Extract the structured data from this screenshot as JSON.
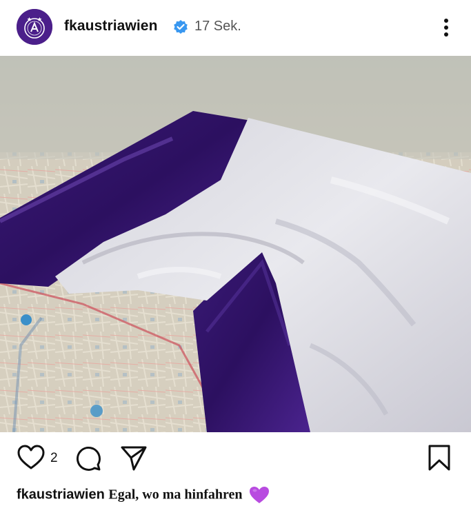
{
  "post": {
    "username": "fkaustriawien",
    "time": "17 Sek.",
    "avatar_icon": "club-crest-icon",
    "verified_icon": "verified-badge-icon",
    "more_icon": "more-vertical-icon"
  },
  "image": {
    "description": "photo"
  },
  "actions": {
    "like_icon": "heart-outline-icon",
    "like_count": "2",
    "comment_icon": "comment-bubble-icon",
    "share_icon": "paper-plane-icon",
    "save_icon": "bookmark-icon"
  },
  "caption": {
    "username": "fkaustriawien",
    "text": "Egal, wo ma hinfahren",
    "emoji": "purple-heart-emoji"
  },
  "colors": {
    "brand_purple": "#4b1f8a",
    "verified_blue": "#3897f0",
    "emoji_purple": "#b84be0"
  }
}
